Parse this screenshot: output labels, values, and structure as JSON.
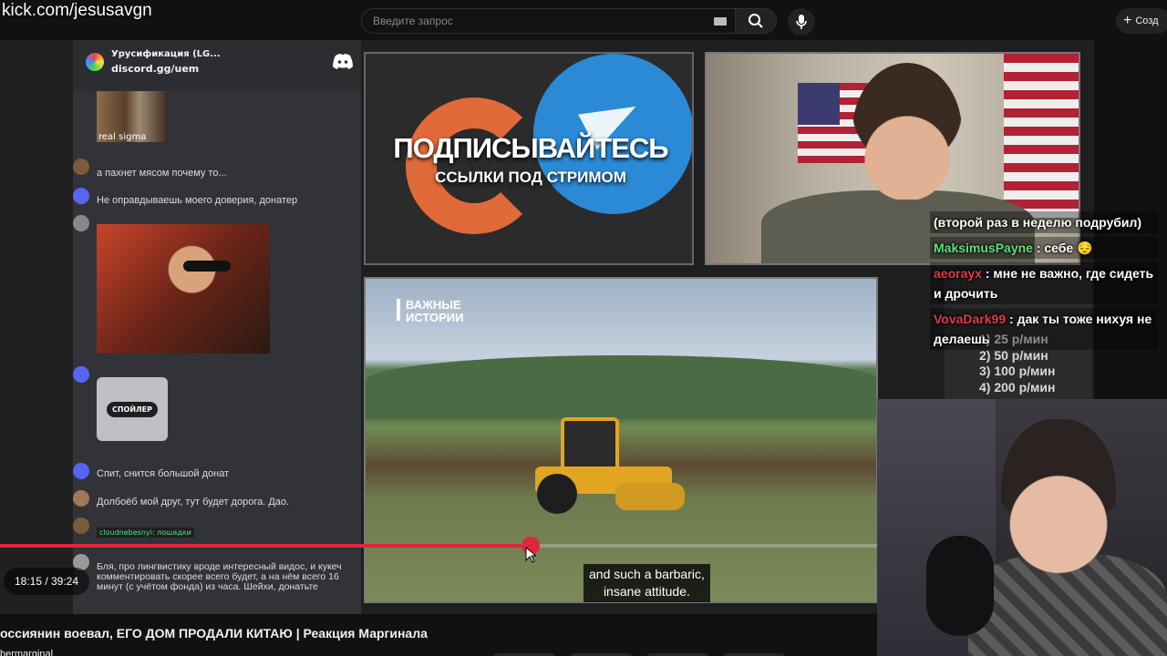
{
  "overlay_url": "kick.com/jesusavgn",
  "search": {
    "placeholder": "Введите запрос"
  },
  "header": {
    "create_label": "Созд"
  },
  "discord": {
    "server_name": "Урусификация (LG...",
    "invite": "discord.gg/uem",
    "image_caption": "real sigma",
    "messages": [
      {
        "text": "а пахнет мясом почему то..."
      },
      {
        "text": "Не оправдываешь моего доверия, донатер"
      },
      {
        "text": "Спит, снится большой донат"
      },
      {
        "text": "Долбоёб мой друг, тут будет дорога. Дао."
      },
      {
        "text": "Бля, про лингвистику вроде интересный видос, и кукеч комментировать скорее всего будет, а на нём всего 16 минут (с учётом фонда) из часа. Шейхи, донатьте"
      }
    ],
    "spoiler_label": "СПОЙЛЕР",
    "nickname_tag": "cloudnebesnyi: лошадки"
  },
  "promo": {
    "headline": "ПОДПИСЫВАЙТЕСЬ",
    "subline": "ССЫЛКИ ПОД СТРИМОМ"
  },
  "news": {
    "brand_line1": "ВАЖНЫЕ",
    "brand_line2": "ИСТОРИИ"
  },
  "subtitles": {
    "line1": "and such a barbaric,",
    "line2": "insane attitude."
  },
  "chat": [
    {
      "name": "",
      "text": "(второй раз в неделю подрубил)"
    },
    {
      "name": "MaksimusPayne",
      "text": ": себе 😔"
    },
    {
      "name": "aeorayx",
      "text": ": мне не важно, где сидеть и дрочить"
    },
    {
      "name": "VovaDark99",
      "text": ": дак ты тоже нихуя не делаешь"
    }
  ],
  "prices": [
    "1) 25 р/мин",
    "2) 50 р/мин",
    "3) 100 р/мин",
    "4) 200 р/мин"
  ],
  "player": {
    "time": "18:15 / 39:24",
    "progress": 0.6
  },
  "video": {
    "title": "оссиянин воевал, ЕГО ДОМ ПРОДАЛИ КИТАЮ | Реакция Маргинала",
    "channel": "bermarginal"
  }
}
